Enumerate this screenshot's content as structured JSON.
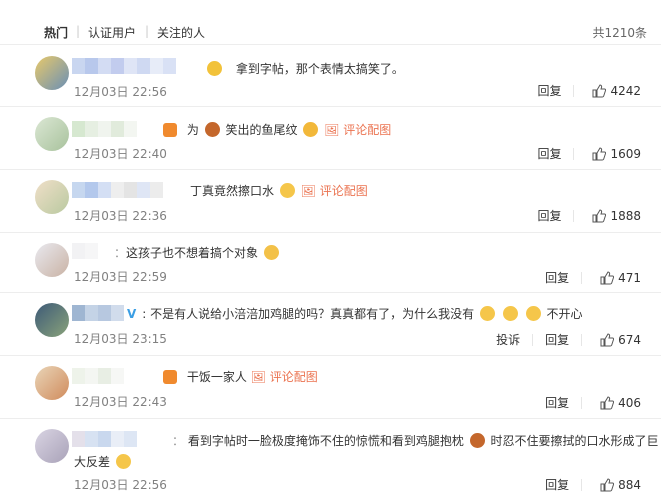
{
  "tabs": {
    "hot": "热门",
    "verified": "认证用户",
    "following": "关注的人",
    "total": "共1210条"
  },
  "actions": {
    "reply": "回复",
    "report": "投诉",
    "view_image": "评论配图"
  },
  "comments": [
    {
      "text": "拿到字帖，那个表情太搞笑了。",
      "time": "12月03日 22:56",
      "likes": "4242"
    },
    {
      "text_a": "为",
      "text_b": "笑出的鱼尾纹",
      "time": "12月03日 22:40",
      "likes": "1609"
    },
    {
      "text": "丁真竟然擦口水",
      "time": "12月03日 22:36",
      "likes": "1888"
    },
    {
      "text": "这孩子也不想着搞个对象",
      "time": "12月03日 22:59",
      "likes": "471"
    },
    {
      "text_a": "不是有人说给小涪涪加鸡腿的吗？真真都有了，为什么我没有",
      "text_b": "不开心",
      "time": "12月03日 23:15",
      "likes": "674"
    },
    {
      "text": "干饭一家人",
      "time": "12月03日 22:43",
      "likes": "406"
    },
    {
      "text_a": "看到字帖时一脸极度掩饰不住的惊慌和看到鸡腿抱枕",
      "text_b": "时忍不住要擦拭的口水形成了巨",
      "line2": "大反差",
      "time": "12月03日 22:56",
      "likes": "884"
    }
  ]
}
